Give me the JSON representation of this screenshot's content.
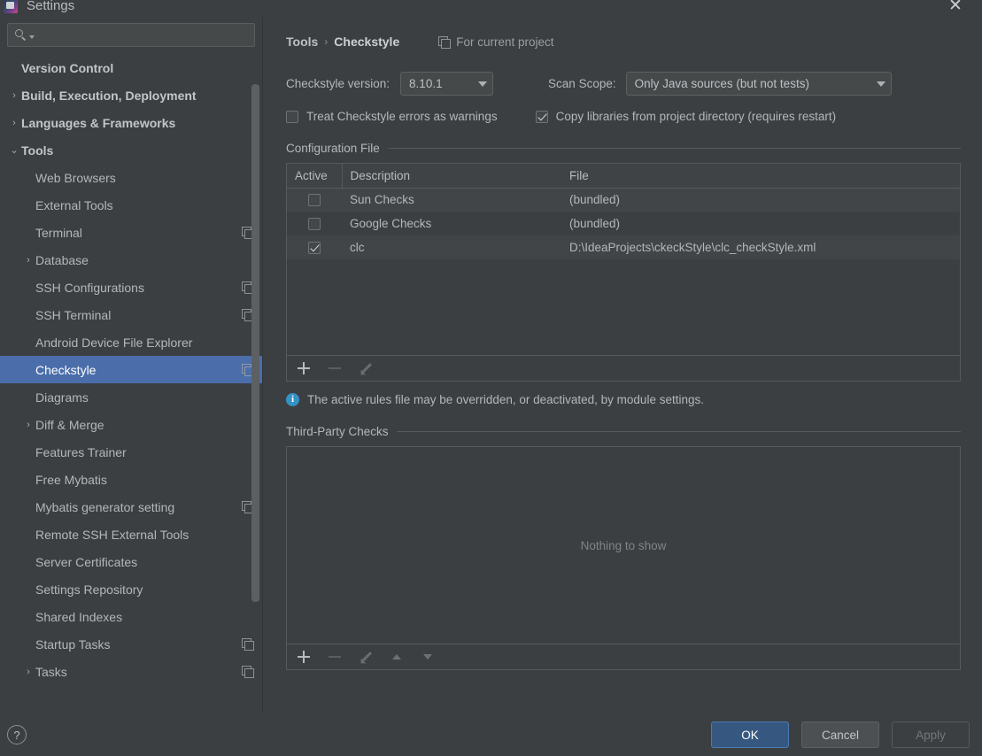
{
  "window": {
    "title": "Settings",
    "app_icon": "intellij-idea-icon",
    "close_label": "✕"
  },
  "sidebar": {
    "search": {
      "placeholder": "",
      "value": "",
      "icon": "search-icon"
    },
    "items": [
      {
        "label": "Version Control",
        "level": 0,
        "arrow": "",
        "bold": true,
        "copy": false,
        "selected": false
      },
      {
        "label": "Build, Execution, Deployment",
        "level": 0,
        "arrow": "›",
        "bold": true,
        "copy": false,
        "selected": false
      },
      {
        "label": "Languages & Frameworks",
        "level": 0,
        "arrow": "›",
        "bold": true,
        "copy": false,
        "selected": false
      },
      {
        "label": "Tools",
        "level": 0,
        "arrow": "⌄",
        "bold": true,
        "copy": false,
        "selected": false
      },
      {
        "label": "Web Browsers",
        "level": 1,
        "arrow": "",
        "bold": false,
        "copy": false,
        "selected": false
      },
      {
        "label": "External Tools",
        "level": 1,
        "arrow": "",
        "bold": false,
        "copy": false,
        "selected": false
      },
      {
        "label": "Terminal",
        "level": 1,
        "arrow": "",
        "bold": false,
        "copy": true,
        "selected": false
      },
      {
        "label": "Database",
        "level": 1,
        "arrow": "›",
        "bold": false,
        "copy": false,
        "selected": false
      },
      {
        "label": "SSH Configurations",
        "level": 1,
        "arrow": "",
        "bold": false,
        "copy": true,
        "selected": false
      },
      {
        "label": "SSH Terminal",
        "level": 1,
        "arrow": "",
        "bold": false,
        "copy": true,
        "selected": false
      },
      {
        "label": "Android Device File Explorer",
        "level": 1,
        "arrow": "",
        "bold": false,
        "copy": false,
        "selected": false
      },
      {
        "label": "Checkstyle",
        "level": 1,
        "arrow": "",
        "bold": false,
        "copy": true,
        "selected": true
      },
      {
        "label": "Diagrams",
        "level": 1,
        "arrow": "",
        "bold": false,
        "copy": false,
        "selected": false
      },
      {
        "label": "Diff & Merge",
        "level": 1,
        "arrow": "›",
        "bold": false,
        "copy": false,
        "selected": false
      },
      {
        "label": "Features Trainer",
        "level": 1,
        "arrow": "",
        "bold": false,
        "copy": false,
        "selected": false
      },
      {
        "label": "Free Mybatis",
        "level": 1,
        "arrow": "",
        "bold": false,
        "copy": false,
        "selected": false
      },
      {
        "label": "Mybatis generator setting",
        "level": 1,
        "arrow": "",
        "bold": false,
        "copy": true,
        "selected": false
      },
      {
        "label": "Remote SSH External Tools",
        "level": 1,
        "arrow": "",
        "bold": false,
        "copy": false,
        "selected": false
      },
      {
        "label": "Server Certificates",
        "level": 1,
        "arrow": "",
        "bold": false,
        "copy": false,
        "selected": false
      },
      {
        "label": "Settings Repository",
        "level": 1,
        "arrow": "",
        "bold": false,
        "copy": false,
        "selected": false
      },
      {
        "label": "Shared Indexes",
        "level": 1,
        "arrow": "",
        "bold": false,
        "copy": false,
        "selected": false
      },
      {
        "label": "Startup Tasks",
        "level": 1,
        "arrow": "",
        "bold": false,
        "copy": true,
        "selected": false
      },
      {
        "label": "Tasks",
        "level": 1,
        "arrow": "›",
        "bold": false,
        "copy": true,
        "selected": false
      }
    ]
  },
  "main": {
    "breadcrumb": {
      "parent": "Tools",
      "separator": "›",
      "current": "Checkstyle"
    },
    "scope_tag": {
      "label": "For current project",
      "icon": "copy-icon"
    },
    "version_field": {
      "label": "Checkstyle version:",
      "value": "8.10.1"
    },
    "scan_scope_field": {
      "label": "Scan Scope:",
      "value": "Only Java sources (but not tests)"
    },
    "checkbox_warnings": {
      "label": "Treat Checkstyle errors as warnings",
      "checked": false
    },
    "checkbox_copy_libs": {
      "label": "Copy libraries from project directory (requires restart)",
      "checked": true
    },
    "config_group": {
      "title": "Configuration File",
      "columns": [
        "Active",
        "Description",
        "File"
      ],
      "rows": [
        {
          "active": false,
          "description": "Sun Checks",
          "file": "(bundled)"
        },
        {
          "active": false,
          "description": "Google Checks",
          "file": "(bundled)"
        },
        {
          "active": true,
          "description": "clc",
          "file": "D:\\IdeaProjects\\ckeckStyle\\clc_checkStyle.xml"
        }
      ],
      "toolbar": [
        {
          "name": "add-button",
          "glyph": "+",
          "enabled": true
        },
        {
          "name": "remove-button",
          "glyph": "−",
          "enabled": false
        },
        {
          "name": "edit-button",
          "glyph": "✎",
          "enabled": false
        }
      ]
    },
    "info_message": "The active rules file may be overridden, or deactivated, by module settings.",
    "third_party_group": {
      "title": "Third-Party Checks",
      "empty_text": "Nothing to show",
      "toolbar": [
        {
          "name": "add-button",
          "glyph": "+",
          "enabled": true
        },
        {
          "name": "remove-button",
          "glyph": "−",
          "enabled": false
        },
        {
          "name": "edit-button",
          "glyph": "✎",
          "enabled": false
        },
        {
          "name": "move-up-button",
          "glyph": "▲",
          "enabled": false
        },
        {
          "name": "move-down-button",
          "glyph": "▼",
          "enabled": false
        }
      ]
    }
  },
  "footer": {
    "help_label": "?",
    "ok_label": "OK",
    "cancel_label": "Cancel",
    "apply_label": "Apply",
    "apply_enabled": false
  },
  "colors": {
    "background": "#3c3f41",
    "panel_alt": "#414548",
    "selection_blue": "#4b6eab",
    "primary_button": "#365880",
    "info_blue": "#3592c4",
    "border": "#555a5d",
    "text": "#b4b7ba",
    "text_muted": "#808487"
  }
}
